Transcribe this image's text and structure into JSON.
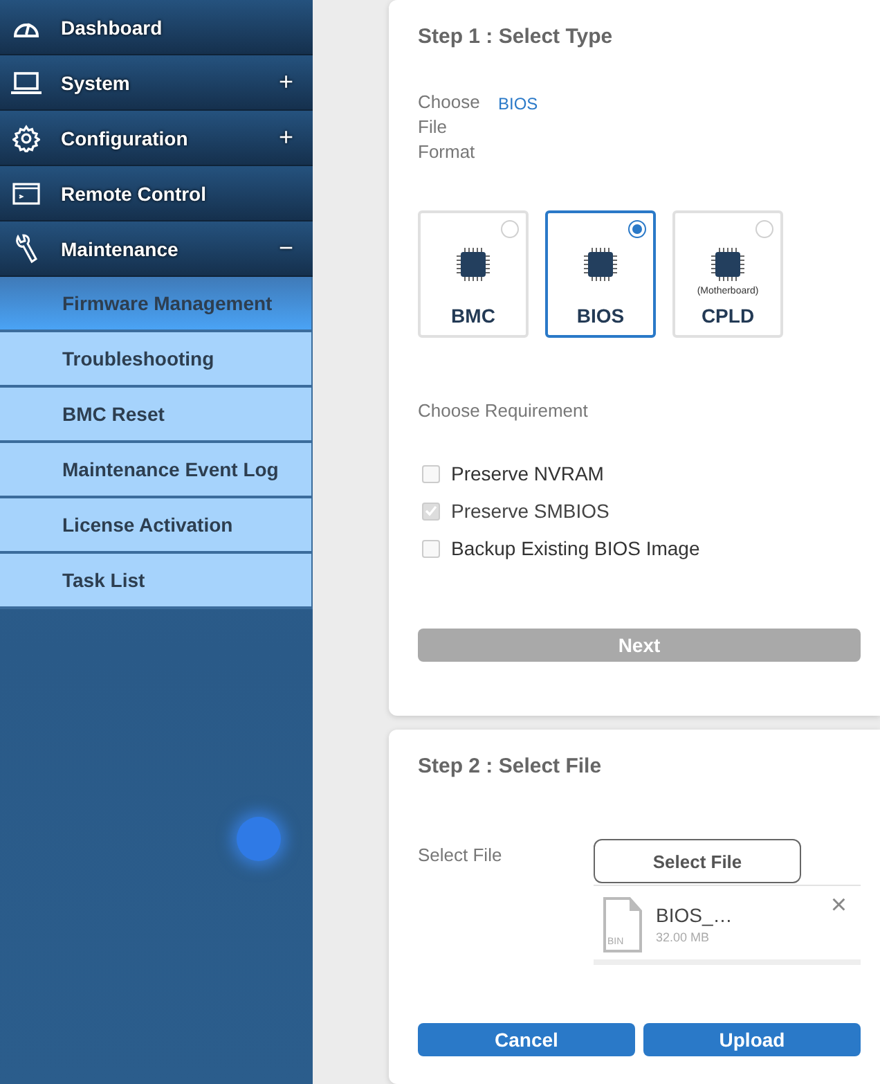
{
  "sidebar": {
    "items": [
      {
        "label": "Dashboard"
      },
      {
        "label": "System",
        "expander": "+"
      },
      {
        "label": "Configuration",
        "expander": "+"
      },
      {
        "label": "Remote Control"
      },
      {
        "label": "Maintenance",
        "expander": "−",
        "children": [
          {
            "label": "Firmware Management",
            "selected": true
          },
          {
            "label": "Troubleshooting",
            "selected": false
          },
          {
            "label": "BMC Reset",
            "selected": false
          },
          {
            "label": "Maintenance Event Log",
            "selected": false
          },
          {
            "label": "License Activation",
            "selected": false
          },
          {
            "label": "Task List",
            "selected": false
          }
        ]
      }
    ]
  },
  "step1": {
    "title": "Step 1 : Select Type",
    "format_label": "Choose File Format",
    "format_value": "BIOS",
    "types": [
      {
        "label": "BMC",
        "selected": false
      },
      {
        "label": "BIOS",
        "selected": true
      },
      {
        "label": "CPLD",
        "sublabel": "(Motherboard)",
        "selected": false
      }
    ],
    "requirement_label": "Choose Requirement",
    "requirements": [
      {
        "label": "Preserve NVRAM",
        "checked": false,
        "disabled": false
      },
      {
        "label": "Preserve SMBIOS",
        "checked": true,
        "disabled": true
      },
      {
        "label": "Backup Existing BIOS Image",
        "checked": false,
        "disabled": false
      }
    ],
    "next": {
      "label": "Next",
      "disabled": true
    }
  },
  "step2": {
    "title": "Step 2 : Select File",
    "file_label": "Select File",
    "select_button": "Select File",
    "file": {
      "type": "BIN",
      "name": "BIOS_…",
      "size": "32.00 MB",
      "remove": "×"
    },
    "buttons": [
      "Cancel",
      "Upload"
    ]
  }
}
